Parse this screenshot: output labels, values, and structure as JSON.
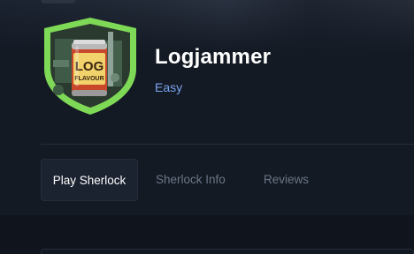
{
  "sherlock": {
    "title": "Logjammer",
    "difficulty": "Easy",
    "logo": {
      "label_line1": "LOG",
      "label_line2": "FLAVOUR",
      "badge_color": "#7ed957"
    }
  },
  "tabs": [
    {
      "label": "Play Sherlock",
      "active": true
    },
    {
      "label": "Sherlock Info",
      "active": false
    },
    {
      "label": "Reviews",
      "active": false
    }
  ],
  "colors": {
    "background": "#141a24",
    "accent_difficulty": "#7ba4f0"
  }
}
